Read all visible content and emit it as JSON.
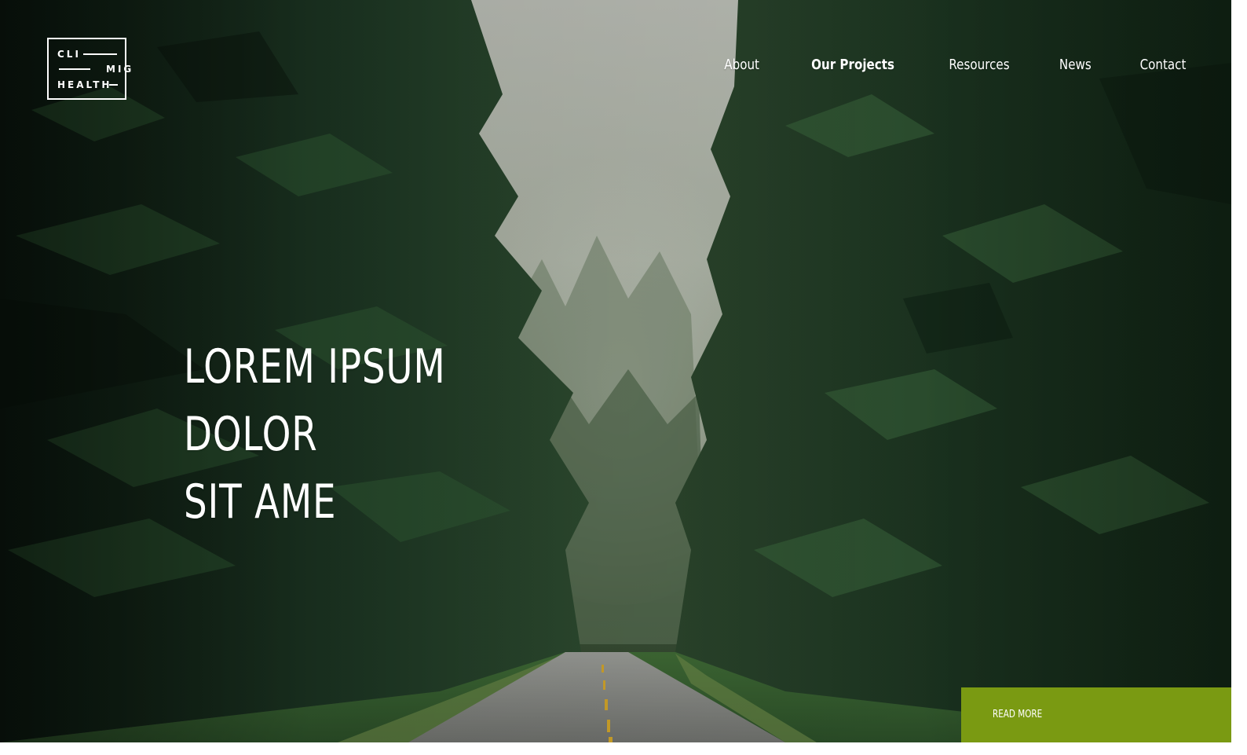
{
  "logo": {
    "line1": "CLI",
    "line2": "MIG",
    "line3": "HEALTH"
  },
  "nav": {
    "items": [
      {
        "label": "About",
        "active": false
      },
      {
        "label": "Our Projects",
        "active": true
      },
      {
        "label": "Resources",
        "active": false
      },
      {
        "label": "News",
        "active": false
      },
      {
        "label": "Contact",
        "active": false
      }
    ]
  },
  "hero": {
    "headline_line1": "LOREM IPSUM DOLOR",
    "headline_line2": "SIT AME",
    "cta_label": "READ MORE",
    "background": "forest-road-photo"
  },
  "colors": {
    "accent": "#7a9a12",
    "text": "#ffffff",
    "forest_dark": "#1a2b1e"
  }
}
